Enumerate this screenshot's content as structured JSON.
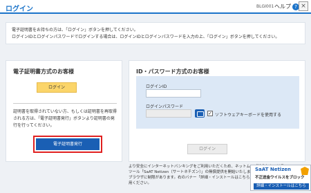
{
  "header": {
    "title": "ログイン",
    "code": "BLGI001",
    "help_label": "ヘルプ",
    "help_icon_glyph": "?",
    "close_glyph": "×"
  },
  "info": {
    "line1": "電子証明書をお持ちの方は、「ログイン」ボタンを押してください。",
    "line2": "ログインIDとログインパスワードでログインする場合は、ログインIDとログインパスワードを入力の上、「ログイン」ボタンを押してください。"
  },
  "cert_card": {
    "heading": "電子証明書方式のお客様",
    "login_label": "ログイン",
    "description": "証明書を取得されていない方、もしくは証明書を再取得される方は、「電子証明書発行」ボタンより証明書の発行を行ってください。",
    "issue_label": "電子証明書発行"
  },
  "id_card": {
    "heading": "ID・パスワード方式のお客様",
    "id_label": "ログインID",
    "id_value": "",
    "password_label": "ログインパスワード",
    "password_value": "",
    "software_keyboard_label": "ソフトウェアキーボードを使用する",
    "software_keyboard_checked": true,
    "check_glyph": "✓",
    "login_label": "ログイン"
  },
  "footer": {
    "note": "より安全にインターネットバンキングをご利用いただくため、ネットムーブ社のセキュリティツール「SaAT Netizen（サートネチズン）」の無償提供を開始いたしました。ご利用可能OS/ブラウザに制限があります。右のバナー「詳細・インストールはこちら」でご確認のうえご利用ください。"
  },
  "banner": {
    "brand": "SaAT Netizen",
    "subtitle": "不正送金ウイルスをブロック",
    "download_label": "詳細・インストールはこちら"
  },
  "colors": {
    "accent": "#1a73c9",
    "primary_button": "#1a5fb4",
    "yellow_button": "#fbd56a",
    "highlight_border": "#e02020",
    "panel": "#dce8f6"
  }
}
